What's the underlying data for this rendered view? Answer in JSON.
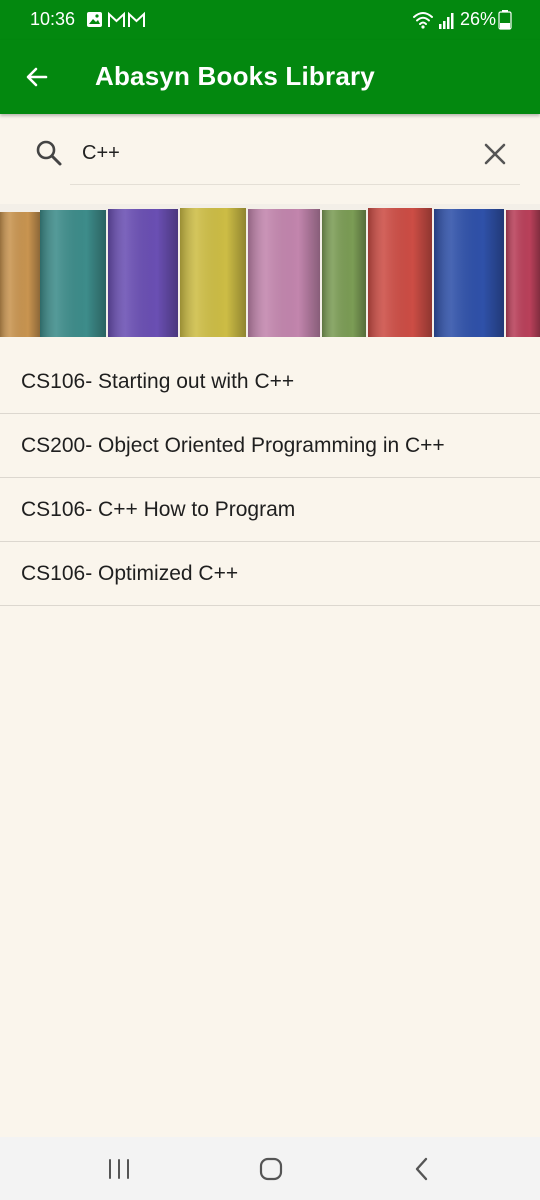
{
  "status_bar": {
    "time": "10:36",
    "battery_percent": "26%",
    "notification_icons": [
      "image-icon",
      "gmail-icon",
      "gmail-icon"
    ],
    "system_icons": [
      "wifi-icon",
      "signal-icon",
      "battery-icon"
    ]
  },
  "app_bar": {
    "title": "Abasyn Books Library",
    "back_icon": "arrow-left-icon",
    "background_color": "#03880f"
  },
  "search": {
    "value": "C++",
    "search_icon": "search-icon",
    "clear_icon": "close-icon"
  },
  "books": [
    {
      "title": "CS106- Starting out with C++"
    },
    {
      "title": "CS200- Object Oriented Programming in C++"
    },
    {
      "title": "CS106- C++ How to Program"
    },
    {
      "title": "CS106- Optimized C++"
    }
  ],
  "nav_bar": {
    "recent_icon": "recent-apps-icon",
    "home_icon": "home-icon",
    "back_icon": "back-icon"
  }
}
